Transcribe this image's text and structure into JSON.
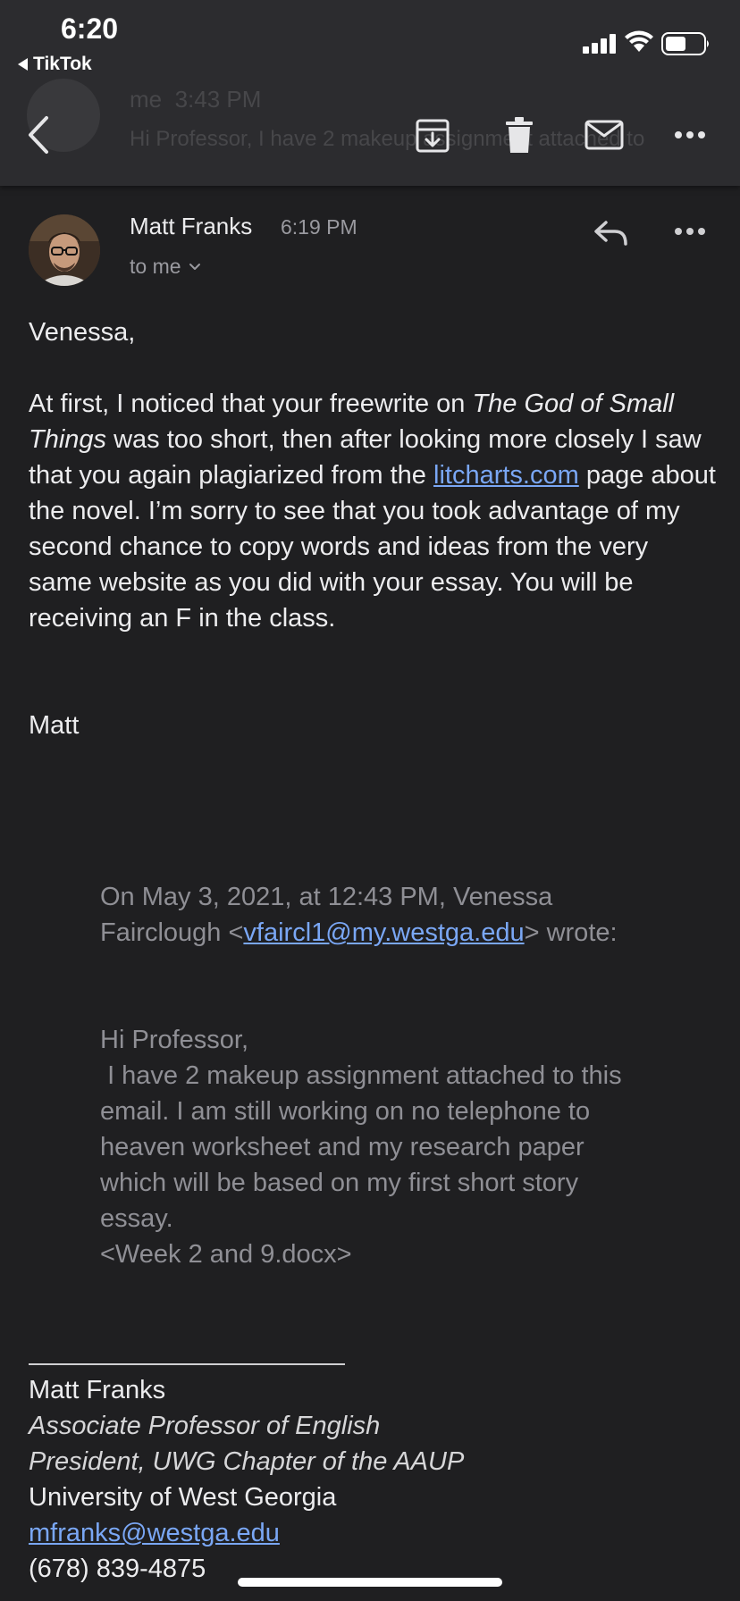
{
  "status_bar": {
    "time": "6:20",
    "back_app_label": "TikTok"
  },
  "toolbar": {
    "back_icon": "chevron-left-icon",
    "archive_icon": "archive-icon",
    "delete_icon": "trash-icon",
    "mark_unread_icon": "mail-icon",
    "more_icon": "more-horizontal-icon",
    "ghost_prev_sender": "me",
    "ghost_prev_time": "3:43 PM",
    "ghost_prev_snippet": "Hi Professor, I have 2 makeup assignment attached to"
  },
  "message": {
    "sender_name": "Matt Franks",
    "time": "6:19 PM",
    "recipient": "to me",
    "greeting": "Venessa,",
    "para1_a": "At first, I noticed that your freewrite on ",
    "para1_title": "The God of Small Things",
    "para1_b": " was too short, then after looking more closely I saw that you again plagiarized from the ",
    "para1_link": "litcharts.com",
    "para1_c": " page about the novel. I’m sorry to see that you took advantage of my second chance to copy words and ideas from the very same website as you did with your essay. You will be receiving an F in the class.",
    "signoff": "Matt"
  },
  "quoted": {
    "intro_a": "On May 3, 2021, at 12:43 PM, Venessa Fairclough <",
    "intro_email": "vfaircl1@my.westga.edu",
    "intro_b": "> wrote:",
    "greeting": "Hi Professor,",
    "body": " I have 2 makeup assignment attached to this email. I am still working on no telephone to heaven worksheet and my research paper which will be based on my first short story essay.",
    "attachment": "<Week 2 and 9.docx>"
  },
  "signature": {
    "name": "Matt Franks",
    "title1": "Associate Professor of English",
    "title2": "President, UWG Chapter of the AAUP",
    "org": "University of West Georgia",
    "email": "mfranks@westga.edu",
    "phone": "(678) 839-4875"
  },
  "colors": {
    "background": "#1f1f21",
    "toolbar": "#2c2c2f",
    "link": "#7aa7f5",
    "muted": "#9a9aa0"
  }
}
